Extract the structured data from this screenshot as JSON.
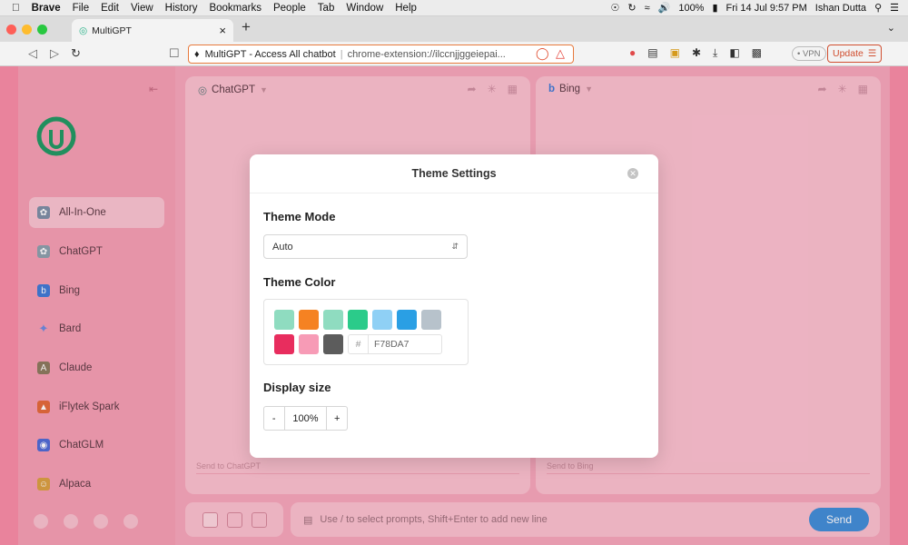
{
  "menubar": {
    "items": [
      "Brave",
      "File",
      "Edit",
      "View",
      "History",
      "Bookmarks",
      "People",
      "Tab",
      "Window",
      "Help"
    ],
    "battery": "100%",
    "datetime": "Fri 14 Jul  9:57 PM",
    "user": "Ishan Dutta"
  },
  "tab": {
    "title": "MultiGPT",
    "close": "×",
    "new": "+"
  },
  "address": {
    "site_title": "MultiGPT - Access All chatbot",
    "url": "chrome-extension://ilccnjjggeiepai..."
  },
  "toolbar": {
    "vpn": "• VPN",
    "update": "Update"
  },
  "sidebar": {
    "items": [
      {
        "label": "All-In-One",
        "color": "#7b8fa6"
      },
      {
        "label": "ChatGPT",
        "color": "#8aa0ad"
      },
      {
        "label": "Bing",
        "color": "#3d7ad6"
      },
      {
        "label": "Bard",
        "color": "#6a8ae0"
      },
      {
        "label": "Claude",
        "color": "#8a7a5e"
      },
      {
        "label": "iFlytek Spark",
        "color": "#e26a3a"
      },
      {
        "label": "ChatGLM",
        "color": "#4c6bd6"
      },
      {
        "label": "Alpaca",
        "color": "#d8a040"
      }
    ]
  },
  "panels": {
    "left": {
      "name": "ChatGPT",
      "input_placeholder": "Send to ChatGPT"
    },
    "right": {
      "name": "Bing",
      "input_placeholder": "Send to Bing"
    }
  },
  "prompt": {
    "placeholder": "Use / to select prompts, Shift+Enter to add new line",
    "send": "Send"
  },
  "modal": {
    "title": "Theme Settings",
    "theme_mode_label": "Theme Mode",
    "theme_mode_value": "Auto",
    "theme_color_label": "Theme Color",
    "swatches": [
      "#8fdcc0",
      "#f58222",
      "#8fdcc0",
      "#2bcb8a",
      "#8fd0f5",
      "#2a9fe4",
      "#b7c2cb",
      "#e82d5e",
      "#f79bb6",
      "#5c5c5c"
    ],
    "hex_value": "F78DA7",
    "display_size_label": "Display size",
    "display_size_value": "100%",
    "minus": "-",
    "plus": "+"
  },
  "colors": {
    "accent": "#f78da7",
    "send": "#3e8ed8",
    "url_border": "#e77a3d"
  }
}
